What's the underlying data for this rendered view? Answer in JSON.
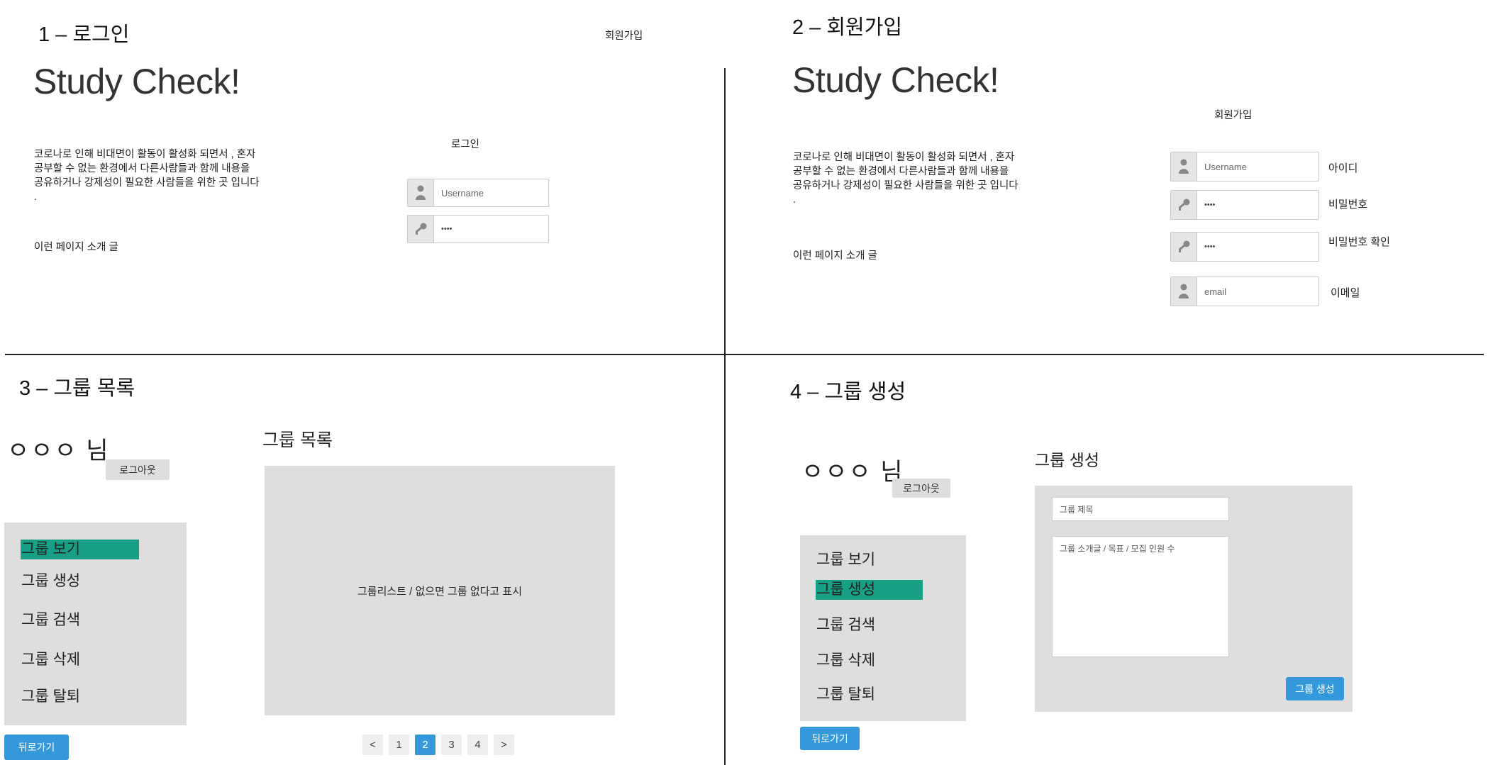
{
  "panel1": {
    "title": "1 – 로그인",
    "signup_link": "회원가입",
    "brand": "Study Check!",
    "description_lines": [
      "코로나로 인해 비대면이 활동이 활성화 되면서 , 혼자",
      "공부할 수 없는 환경에서 다른사람들과 함께 내용을",
      "공유하거나 강제성이 필요한 사람들을 위한 곳 입니다",
      "."
    ],
    "intro": "이런 페이지 소개 글",
    "form_title": "로그인",
    "username_placeholder": "Username",
    "password_mask": "••••",
    "icons": {
      "username": "user-icon",
      "password": "key-icon"
    }
  },
  "panel2": {
    "title": "2 – 회원가입",
    "brand": "Study Check!",
    "description_lines": [
      "코로나로 인해 비대면이 활동이 활성화 되면서 , 혼자",
      "공부할 수 없는 환경에서 다른사람들과 함께 내용을",
      "공유하거나 강제성이 필요한 사람들을 위한 곳 입니다",
      "."
    ],
    "intro": "이런 페이지 소개 글",
    "form_title": "회원가입",
    "fields": [
      {
        "value": "Username",
        "label": "아이디",
        "icon": "user-icon"
      },
      {
        "value": "••••",
        "label": "비밀번호",
        "icon": "key-icon"
      },
      {
        "value": "••••",
        "label": "비밀번호 확인",
        "icon": "key-icon"
      },
      {
        "value": "email",
        "label": "이메일",
        "icon": "user-icon"
      }
    ]
  },
  "panel3": {
    "title": "3 –  그룹 목록",
    "user": "ㅇㅇㅇ 님",
    "logout": "로그아웃",
    "menu": [
      "그룹 보기",
      "그룹 생성",
      "그룹 검색",
      "그룹 삭제",
      "그룹 탈퇴"
    ],
    "active_menu": "그룹 보기",
    "heading": "그룹 목록",
    "list_placeholder": "그룹리스트 / 없으면 그룹 없다고 표시",
    "pagination": [
      "<",
      "1",
      "2",
      "3",
      "4",
      ">"
    ],
    "current_page": "2",
    "back": "뒤로가기"
  },
  "panel4": {
    "title": "4 –  그룹 생성",
    "user": "ㅇㅇㅇ 님",
    "logout": "로그아웃",
    "menu": [
      "그룹 보기",
      "그룹 생성",
      "그룹 검색",
      "그룹 삭제",
      "그룹 탈퇴"
    ],
    "active_menu": "그룹 생성",
    "heading": "그룹 생성",
    "title_placeholder": "그룹 제목",
    "desc_placeholder": "그룹 소개글 / 목표 / 모집 인원 수",
    "submit": "그룹 생성",
    "back": "뒤로가기"
  },
  "colors": {
    "accent_blue": "#3498db",
    "active_green": "#17a085",
    "panel_gray": "#dedede"
  }
}
